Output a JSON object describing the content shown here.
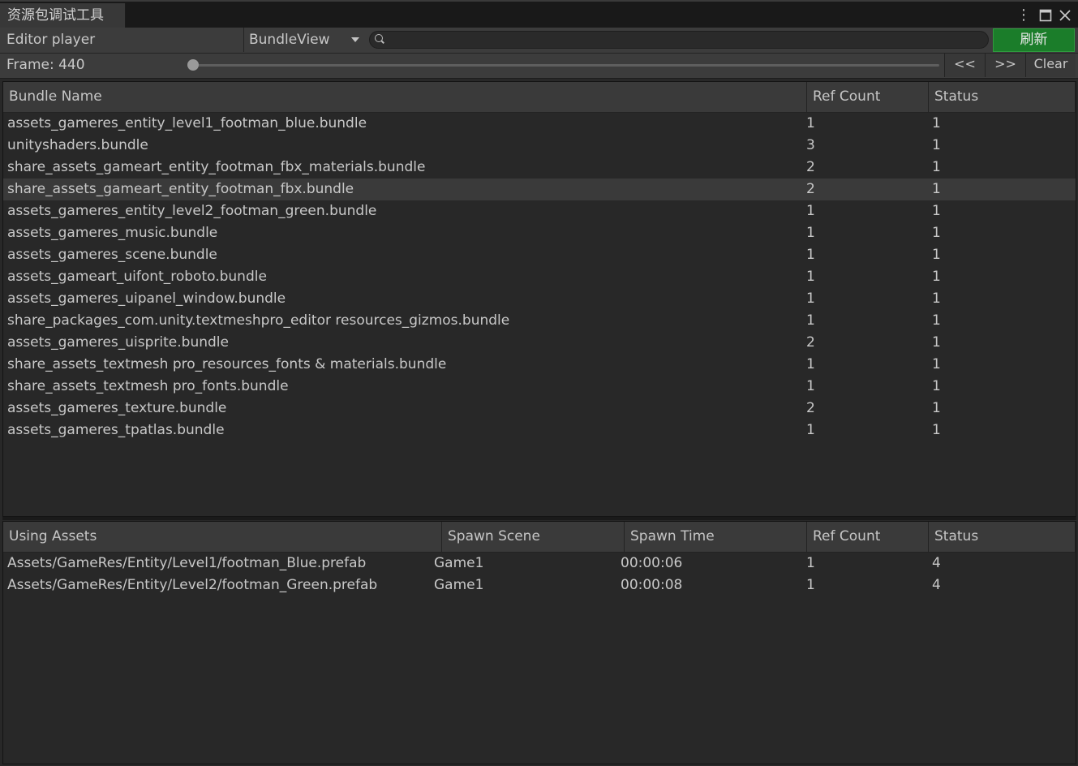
{
  "window": {
    "tab_title": "资源包调试工具",
    "menu_icon": "kebab-icon",
    "maximize_icon": "maximize-icon",
    "close_icon": "close-icon"
  },
  "toolbar": {
    "player_label": "Editor player",
    "view_select": "BundleView",
    "search_value": "",
    "refresh_label": "刷新",
    "refresh_color": "#1b7d2a"
  },
  "frame": {
    "label": "Frame: 440",
    "slider_fraction": 0.0,
    "prev_label": "<<",
    "next_label": ">>",
    "clear_label": "Clear"
  },
  "bundles": {
    "headers": [
      "Bundle Name",
      "Ref Count",
      "Status"
    ],
    "selected_index": 3,
    "rows": [
      {
        "name": "assets_gameres_entity_level1_footman_blue.bundle",
        "ref": "1",
        "status": "1"
      },
      {
        "name": "unityshaders.bundle",
        "ref": "3",
        "status": "1"
      },
      {
        "name": "share_assets_gameart_entity_footman_fbx_materials.bundle",
        "ref": "2",
        "status": "1"
      },
      {
        "name": "share_assets_gameart_entity_footman_fbx.bundle",
        "ref": "2",
        "status": "1"
      },
      {
        "name": "assets_gameres_entity_level2_footman_green.bundle",
        "ref": "1",
        "status": "1"
      },
      {
        "name": "assets_gameres_music.bundle",
        "ref": "1",
        "status": "1"
      },
      {
        "name": "assets_gameres_scene.bundle",
        "ref": "1",
        "status": "1"
      },
      {
        "name": "assets_gameart_uifont_roboto.bundle",
        "ref": "1",
        "status": "1"
      },
      {
        "name": "assets_gameres_uipanel_window.bundle",
        "ref": "1",
        "status": "1"
      },
      {
        "name": "share_packages_com.unity.textmeshpro_editor resources_gizmos.bundle",
        "ref": "1",
        "status": "1"
      },
      {
        "name": "assets_gameres_uisprite.bundle",
        "ref": "2",
        "status": "1"
      },
      {
        "name": "share_assets_textmesh pro_resources_fonts & materials.bundle",
        "ref": "1",
        "status": "1"
      },
      {
        "name": "share_assets_textmesh pro_fonts.bundle",
        "ref": "1",
        "status": "1"
      },
      {
        "name": "assets_gameres_texture.bundle",
        "ref": "2",
        "status": "1"
      },
      {
        "name": "assets_gameres_tpatlas.bundle",
        "ref": "1",
        "status": "1"
      }
    ]
  },
  "assets": {
    "headers": [
      "Using Assets",
      "Spawn Scene",
      "Spawn Time",
      "Ref Count",
      "Status"
    ],
    "rows": [
      {
        "asset": "Assets/GameRes/Entity/Level1/footman_Blue.prefab",
        "scene": "Game1",
        "time": "00:00:06",
        "ref": "1",
        "status": "4"
      },
      {
        "asset": "Assets/GameRes/Entity/Level2/footman_Green.prefab",
        "scene": "Game1",
        "time": "00:00:08",
        "ref": "1",
        "status": "4"
      }
    ]
  }
}
